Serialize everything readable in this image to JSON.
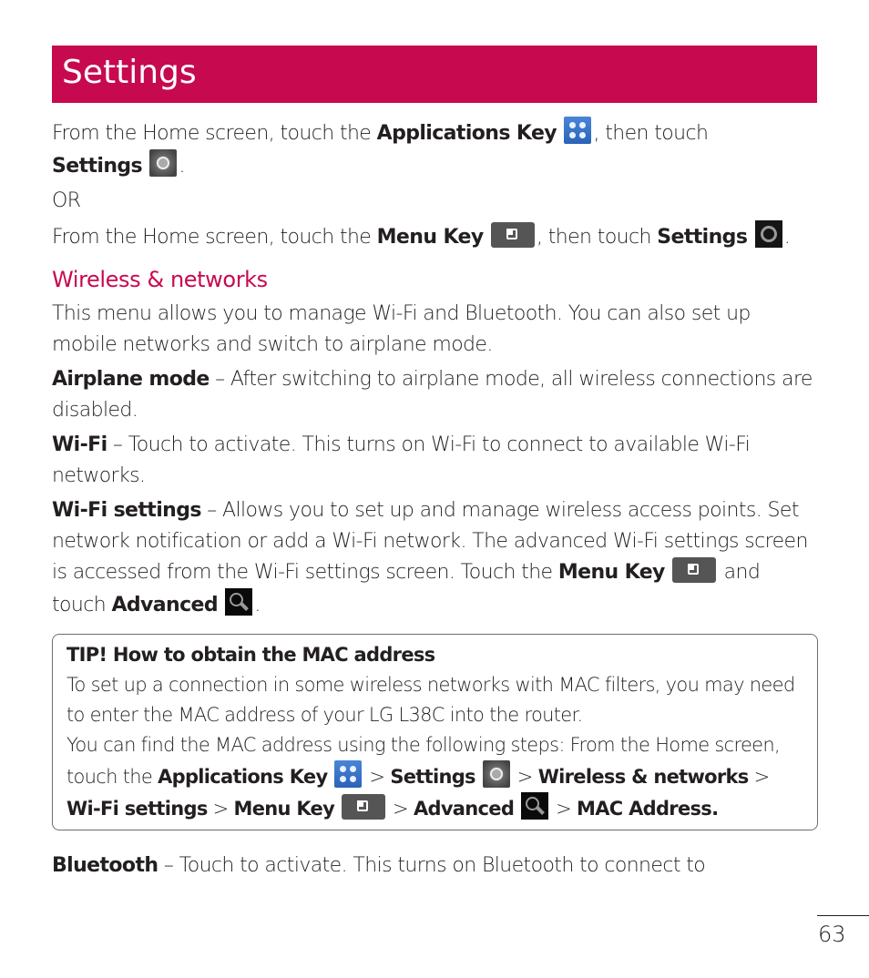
{
  "header": {
    "title": "Settings"
  },
  "intro": {
    "line1_pre": "From the Home screen, touch the ",
    "line1_bold": "Applications Key",
    "line1_post": ", then touch",
    "line2_bold": "Settings",
    "line2_post": ".",
    "or": "OR",
    "line3_pre": "From the Home screen, touch the ",
    "line3_bold1": "Menu Key",
    "line3_mid": ", then touch ",
    "line3_bold2": "Settings",
    "line3_post": "."
  },
  "wireless": {
    "heading": "Wireless & networks",
    "description": "This menu allows you to manage Wi-Fi and Bluetooth. You can also set up mobile networks and switch to airplane mode.",
    "airplane": {
      "term": "Airplane mode",
      "text": " – After switching to airplane mode, all wireless connections are disabled."
    },
    "wifi": {
      "term": "Wi-Fi",
      "text": " – Touch to activate. This turns on Wi-Fi to connect to available Wi-Fi networks."
    },
    "wifi_settings": {
      "term": "Wi-Fi settings",
      "text": " – Allows you to set up and manage wireless access points. Set network notification or add a Wi-Fi network. The advanced Wi-Fi settings screen is accessed from the Wi-Fi settings screen. Touch the ",
      "menu_key": "Menu Key",
      "and_touch": " and touch ",
      "advanced": "Advanced",
      "end": "."
    }
  },
  "tip": {
    "title": "TIP! How to obtain the MAC address",
    "para1": "To set up a connection in some wireless networks with MAC filters, you may need to enter the MAC address of your LG L38C into the router.",
    "para2_pre": "You can find the MAC address using the following steps: From the Home screen, touch the ",
    "apps_key": "Applications Key",
    "sep": " > ",
    "settings": "Settings",
    "wireless": "Wireless & networks",
    "wifi_settings": "Wi-Fi settings",
    "menu_key": "Menu Key",
    "advanced": "Advanced",
    "mac": "MAC Address."
  },
  "bluetooth": {
    "term": "Bluetooth",
    "text": " – Touch to activate. This turns on Bluetooth to connect to"
  },
  "page_number": "63",
  "colors": {
    "accent": "#c7094f",
    "text": "#231f20"
  }
}
